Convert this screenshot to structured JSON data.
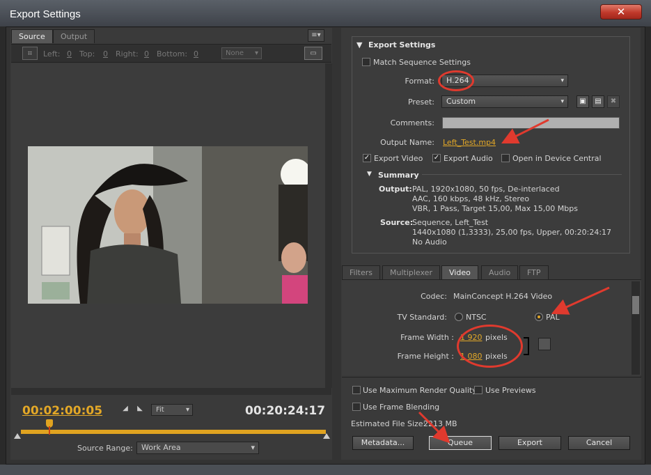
{
  "window": {
    "title": "Export Settings",
    "close_glyph": "✕"
  },
  "left": {
    "tabs": [
      "Source",
      "Output"
    ],
    "panel_menu_glyph": "≡▾",
    "crop": {
      "labels": [
        "Left:",
        "Top:",
        "Right:",
        "Bottom:"
      ],
      "values": [
        "0",
        "0",
        "0",
        "0"
      ],
      "ratio": "None"
    },
    "timecode_current": "00:02:00:05",
    "timecode_duration": "00:20:24:17",
    "fit": "Fit",
    "source_range_label": "Source Range:",
    "source_range_value": "Work Area"
  },
  "settings": {
    "header": "Export Settings",
    "match_sequence": "Match Sequence Settings",
    "format_label": "Format:",
    "format_value": "H.264",
    "preset_label": "Preset:",
    "preset_value": "Custom",
    "comments_label": "Comments:",
    "comments_value": "",
    "output_name_label": "Output Name:",
    "output_name_value": "Left_Test.mp4",
    "export_video": "Export Video",
    "export_audio": "Export Audio",
    "open_device_central": "Open in Device Central",
    "summary_header": "Summary",
    "summary": {
      "output_label": "Output:",
      "output_lines": [
        "PAL, 1920x1080, 50 fps, De-interlaced",
        "AAC, 160 kbps, 48 kHz, Stereo",
        "VBR, 1 Pass, Target 15,00, Max 15,00 Mbps"
      ],
      "source_label": "Source:",
      "source_lines": [
        "Sequence, Left_Test",
        "1440x1080 (1,3333), 25,00 fps, Upper, 00:20:24:17",
        "No Audio"
      ]
    }
  },
  "encoding": {
    "tabs": [
      "Filters",
      "Multiplexer",
      "Video",
      "Audio",
      "FTP"
    ],
    "codec_label": "Codec:",
    "codec_value": "MainConcept H.264 Video",
    "tv_standard_label": "TV Standard:",
    "ntsc": "NTSC",
    "pal": "PAL",
    "frame_width_label": "Frame Width :",
    "frame_width_value": "1 920",
    "frame_height_label": "Frame Height :",
    "frame_height_value": "1 080",
    "pixels": "pixels"
  },
  "bottom": {
    "max_render_quality": "Use Maximum Render Quality",
    "use_previews": "Use Previews",
    "frame_blending": "Use Frame Blending",
    "file_size_label": "Estimated File Size:",
    "file_size_value": "2213 MB",
    "buttons": [
      "Metadata...",
      "Queue",
      "Export",
      "Cancel"
    ]
  },
  "colors": {
    "accent": "#e3a827",
    "annotation": "#e03a2e",
    "panel": "#3a3a3a"
  }
}
